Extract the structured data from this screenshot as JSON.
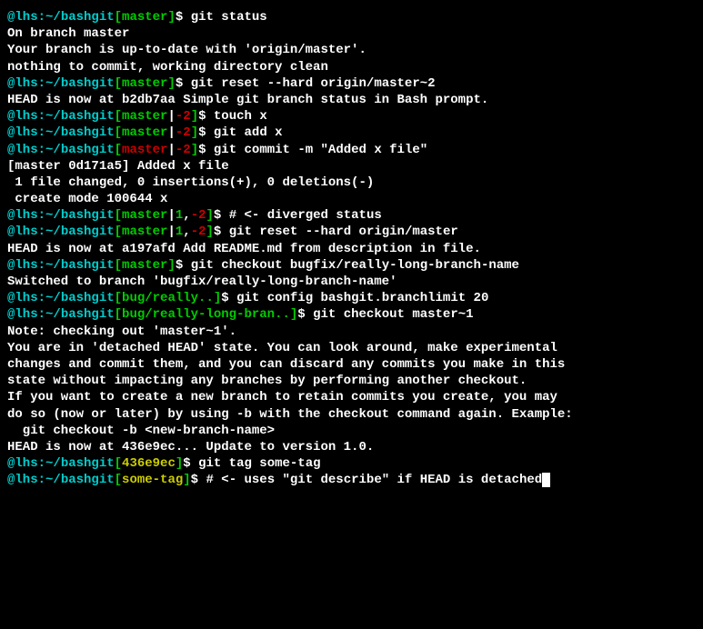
{
  "colors": {
    "cyan": "#00cdcd",
    "green": "#00cd00",
    "yellow": "#cdcd00",
    "red": "#cd0000",
    "white": "#ffffff",
    "black": "#000000"
  },
  "user": "@lhs",
  "host_sep": ":",
  "path": "~/bashgit",
  "lines": {
    "l1": {
      "branch": "master",
      "cmd": "git status"
    },
    "l2": "On branch master",
    "l3": "Your branch is up-to-date with 'origin/master'.",
    "l4": "nothing to commit, working directory clean",
    "l5": {
      "branch": "master",
      "cmd": "git reset --hard origin/master~2"
    },
    "l6": "HEAD is now at b2db7aa Simple git branch status in Bash prompt.",
    "l7": {
      "branch": "master",
      "behind": "-2",
      "cmd": "touch x"
    },
    "l8": {
      "branch": "master",
      "behind": "-2",
      "cmd": "git add x"
    },
    "l9": {
      "branch": "master",
      "behind": "-2",
      "cmd": "git commit -m \"Added x file\""
    },
    "l10": "[master 0d171a5] Added x file",
    "l11": " 1 file changed, 0 insertions(+), 0 deletions(-)",
    "l12": " create mode 100644 x",
    "l13": {
      "branch": "master",
      "ahead": "1",
      "behind": "-2",
      "cmd": "# <- diverged status"
    },
    "l14": {
      "branch": "master",
      "ahead": "1",
      "behind": "-2",
      "cmd": "git reset --hard origin/master"
    },
    "l15": "HEAD is now at a197afd Add README.md from description in file.",
    "l16": {
      "branch": "master",
      "cmd": "git checkout bugfix/really-long-branch-name"
    },
    "l17": "Switched to branch 'bugfix/really-long-branch-name'",
    "l18": {
      "branch": "bug/really..",
      "cmd": "git config bashgit.branchlimit 20"
    },
    "l19": {
      "branch": "bug/really-long-bran..",
      "cmd": "git checkout master~1"
    },
    "l20": "Note: checking out 'master~1'.",
    "l21": "",
    "l22": "You are in 'detached HEAD' state. You can look around, make experimental",
    "l23": "changes and commit them, and you can discard any commits you make in this",
    "l24": "state without impacting any branches by performing another checkout.",
    "l25": "",
    "l26": "If you want to create a new branch to retain commits you create, you may",
    "l27": "do so (now or later) by using -b with the checkout command again. Example:",
    "l28": "",
    "l29": "  git checkout -b <new-branch-name>",
    "l30": "",
    "l31": "HEAD is now at 436e9ec... Update to version 1.0.",
    "l32": {
      "branch_yellow": "436e9ec",
      "cmd": "git tag some-tag"
    },
    "l33": {
      "branch_yellow": "some-tag",
      "cmd": "# <- uses \"git describe\" if HEAD is detached"
    }
  }
}
